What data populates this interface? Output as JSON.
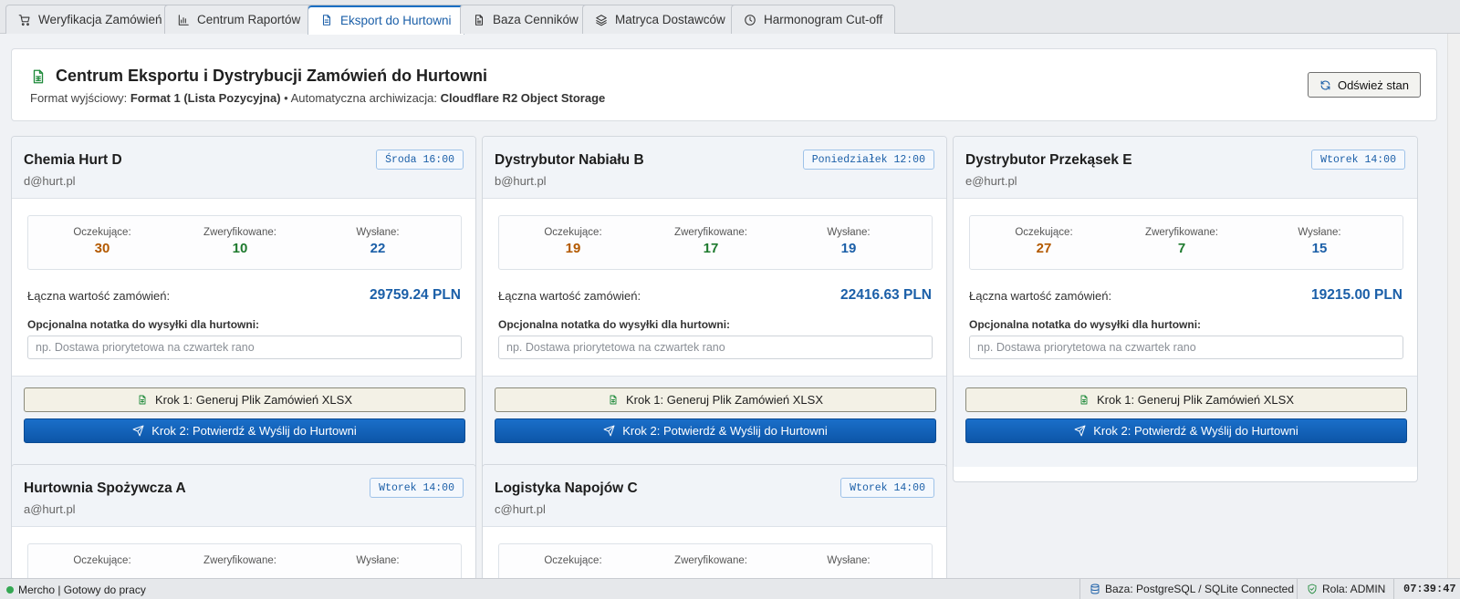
{
  "tabs": [
    {
      "label": "Weryfikacja Zamówień",
      "icon": "cart-icon",
      "active": false
    },
    {
      "label": "Centrum Raportów",
      "icon": "bar-chart-icon",
      "active": false
    },
    {
      "label": "Eksport do Hurtowni",
      "icon": "file-icon",
      "active": true
    },
    {
      "label": "Baza Cenników",
      "icon": "file-text-icon",
      "active": false
    },
    {
      "label": "Matryca Dostawców",
      "icon": "layers-icon",
      "active": false
    },
    {
      "label": "Harmonogram Cut-off",
      "icon": "clock-icon",
      "active": false
    }
  ],
  "header": {
    "title": "Centrum Eksportu i Dystrybucji Zamówień do Hurtowni",
    "format_label": "Format wyjściowy:",
    "format_value": "Format 1 (Lista Pozycyjna)",
    "separator": "•",
    "archive_label": "Automatyczna archiwizacja:",
    "archive_value": "Cloudflare R2 Object Storage",
    "refresh_label": "Odśwież stan"
  },
  "labels": {
    "pending": "Oczekujące:",
    "verified": "Zweryfikowane:",
    "sent": "Wysłane:",
    "total": "Łączna wartość zamówień:",
    "note": "Opcjonalna notatka do wysyłki dla hurtowni:",
    "note_placeholder": "np. Dostawa priorytetowa na czwartek rano",
    "generate": "Krok 1: Generuj Plik Zamówień XLSX",
    "send": "Krok 2: Potwierdź & Wyślij do Hurtowni"
  },
  "wholesalers": [
    {
      "name": "Chemia Hurt D",
      "email": "d@hurt.pl",
      "cutoff": "Środa 16:00",
      "pending": "30",
      "verified": "10",
      "sent": "22",
      "total": "29759.24 PLN"
    },
    {
      "name": "Dystrybutor Nabiału B",
      "email": "b@hurt.pl",
      "cutoff": "Poniedziałek 12:00",
      "pending": "19",
      "verified": "17",
      "sent": "19",
      "total": "22416.63 PLN"
    },
    {
      "name": "Dystrybutor Przekąsek E",
      "email": "e@hurt.pl",
      "cutoff": "Wtorek 14:00",
      "pending": "27",
      "verified": "7",
      "sent": "15",
      "total": "19215.00 PLN"
    },
    {
      "name": "Hurtownia Spożywcza A",
      "email": "a@hurt.pl",
      "cutoff": "Wtorek 14:00"
    },
    {
      "name": "Logistyka Napojów C",
      "email": "c@hurt.pl",
      "cutoff": "Wtorek 14:00"
    }
  ],
  "statusbar": {
    "app_status": "Mercho | Gotowy do pracy",
    "db": "Baza: PostgreSQL / SQLite Connected",
    "role": "Rola: ADMIN",
    "time": "07:39:47"
  },
  "colors": {
    "accent": "#1b5fa8",
    "pending": "#b35900",
    "verified": "#1e7a2e",
    "ok": "#35a853"
  }
}
